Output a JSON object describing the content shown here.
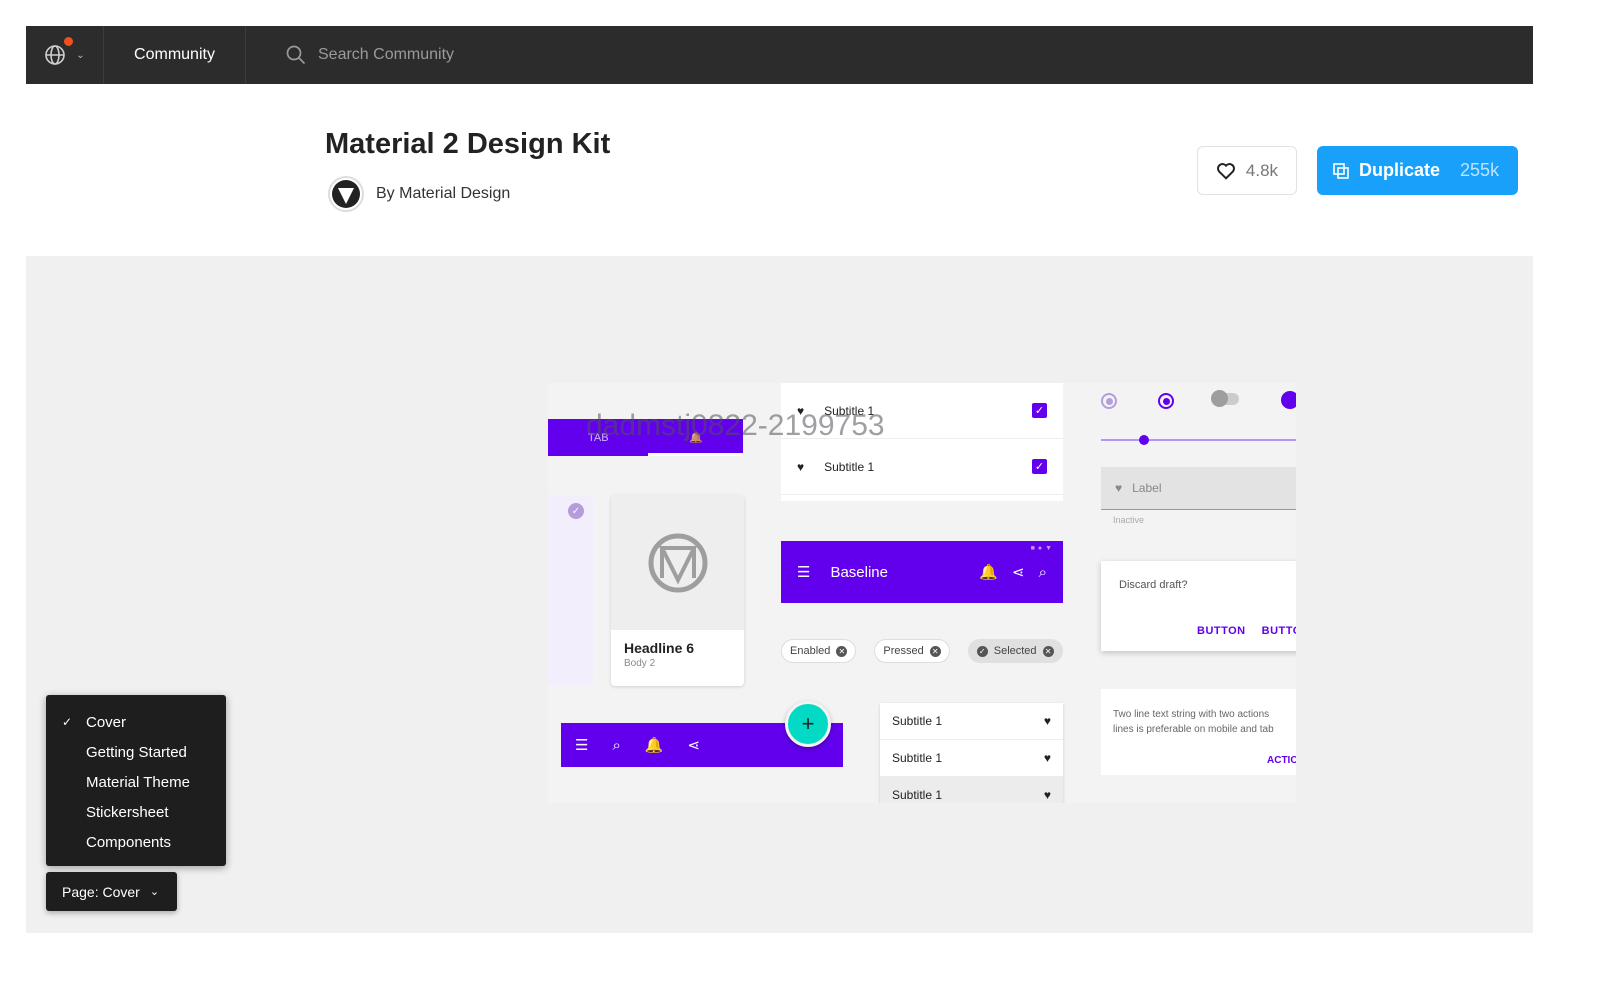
{
  "nav": {
    "community_label": "Community",
    "search_placeholder": "Search Community"
  },
  "file": {
    "title": "Material 2 Design Kit",
    "author": "By Material Design",
    "likes": "4.8k",
    "duplicate_label": "Duplicate",
    "duplicate_count": "255k"
  },
  "preview": {
    "tab_label": "TAB",
    "watermark": "dadmstj0822-2199753",
    "list_top": [
      "Subtitle 1",
      "Subtitle 1"
    ],
    "card_headline": "Headline 6",
    "card_body": "Body 2",
    "appbar_title": "Baseline",
    "chips": [
      "Enabled",
      "Pressed",
      "Selected"
    ],
    "fab": "+",
    "list_bottom": [
      "Subtitle 1",
      "Subtitle 1",
      "Subtitle 1"
    ],
    "textfield_label": "Label",
    "textfield_helper": "Inactive",
    "dialog_text": "Discard draft?",
    "dialog_actions": [
      "BUTTON",
      "BUTTON"
    ],
    "banner_line1": "Two line text string with two actions",
    "banner_line2": "lines is preferable on mobile and tab",
    "banner_action": "ACTION",
    "slider_level": 0.22
  },
  "pages": {
    "items": [
      "Cover",
      "Getting Started",
      "Material Theme",
      "Stickersheet",
      "Components"
    ],
    "selected_index": 0,
    "button_label": "Page: Cover"
  },
  "colors": {
    "primary": "#6200ee",
    "secondary": "#03dac5",
    "duplicate": "#18a0fb",
    "navbar": "#2c2c2c"
  }
}
